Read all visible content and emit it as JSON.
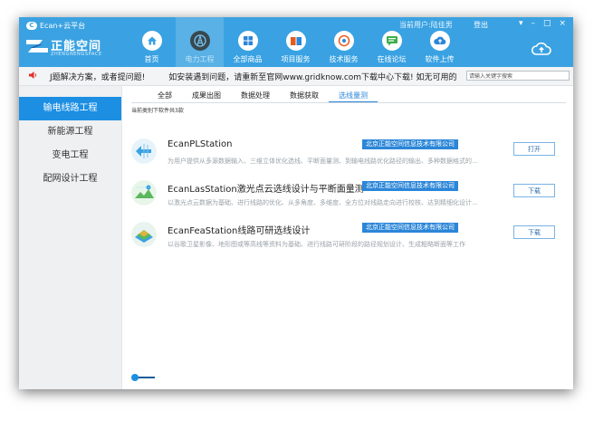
{
  "titlebar": {
    "brand_small": "Ecan+云平台",
    "brand_c": "C",
    "logo_name": "正能空间",
    "logo_sub": "ZHENGNENGSPACE",
    "user_text": "当前用户:陆佳男",
    "logout_label": "登出"
  },
  "nav": [
    {
      "label": "首页",
      "icon": "home-icon",
      "active": false
    },
    {
      "label": "电力工程",
      "icon": "tower-icon",
      "active": true
    },
    {
      "label": "全部商品",
      "icon": "grid-icon",
      "active": false
    },
    {
      "label": "项目服务",
      "icon": "briefcase-icon",
      "active": false
    },
    {
      "label": "技术服务",
      "icon": "support-icon",
      "active": false
    },
    {
      "label": "在线论坛",
      "icon": "chat-icon",
      "active": false
    },
    {
      "label": "软件上传",
      "icon": "upload-icon",
      "active": false
    }
  ],
  "window_controls": [
    "▾",
    "–",
    "□",
    "×"
  ],
  "marquee": {
    "text1": "J题解决方案，或者提问题!",
    "text2": "如安装遇到问题，请重新至官网www.gridknow.com下载中心下载!  如无可用的"
  },
  "search": {
    "placeholder": "请输入关键字搜索"
  },
  "sidebar": {
    "items": [
      "输电线路工程",
      "新能源工程",
      "变电工程",
      "配网设计工程"
    ],
    "active_index": 0
  },
  "tabs": {
    "items": [
      "全部",
      "成果出图",
      "数据处理",
      "数据获取",
      "选线量测"
    ],
    "active_index": 4
  },
  "count_label": "当前类别下软件共3款",
  "software": [
    {
      "title": "EcanPLStation",
      "company": "北京正能空间信息技术有限公司",
      "desc": "为用户提供从多源数据输入、三维立体优化选线、平断面量测、到输电线路优化路径的输出、多种数据格式的...",
      "button": "打开",
      "icon": "pl-station-icon"
    },
    {
      "title": "EcanLasStation激光点云选线设计与平断面量测",
      "company": "北京正能空间信息技术有限公司",
      "desc": "以激光点云数据为基础、进行线路的优化、从多角度、多维度、全方位对线路走向进行校核、达到精细化设计...",
      "button": "下载",
      "icon": "las-station-icon"
    },
    {
      "title": "EcanFeaStation线路可研选线设计",
      "company": "北京正能空间信息技术有限公司",
      "desc": "以谷歌卫星影像、地形图或等高线等资料为基础、进行线路可研阶段的路径规划设计、生成粗略断面等工作",
      "button": "下载",
      "icon": "fea-station-icon"
    }
  ],
  "colors": {
    "titlebar": "#3aa2e2",
    "accent": "#1c8fe3",
    "company_badge": "#2b86d8"
  }
}
